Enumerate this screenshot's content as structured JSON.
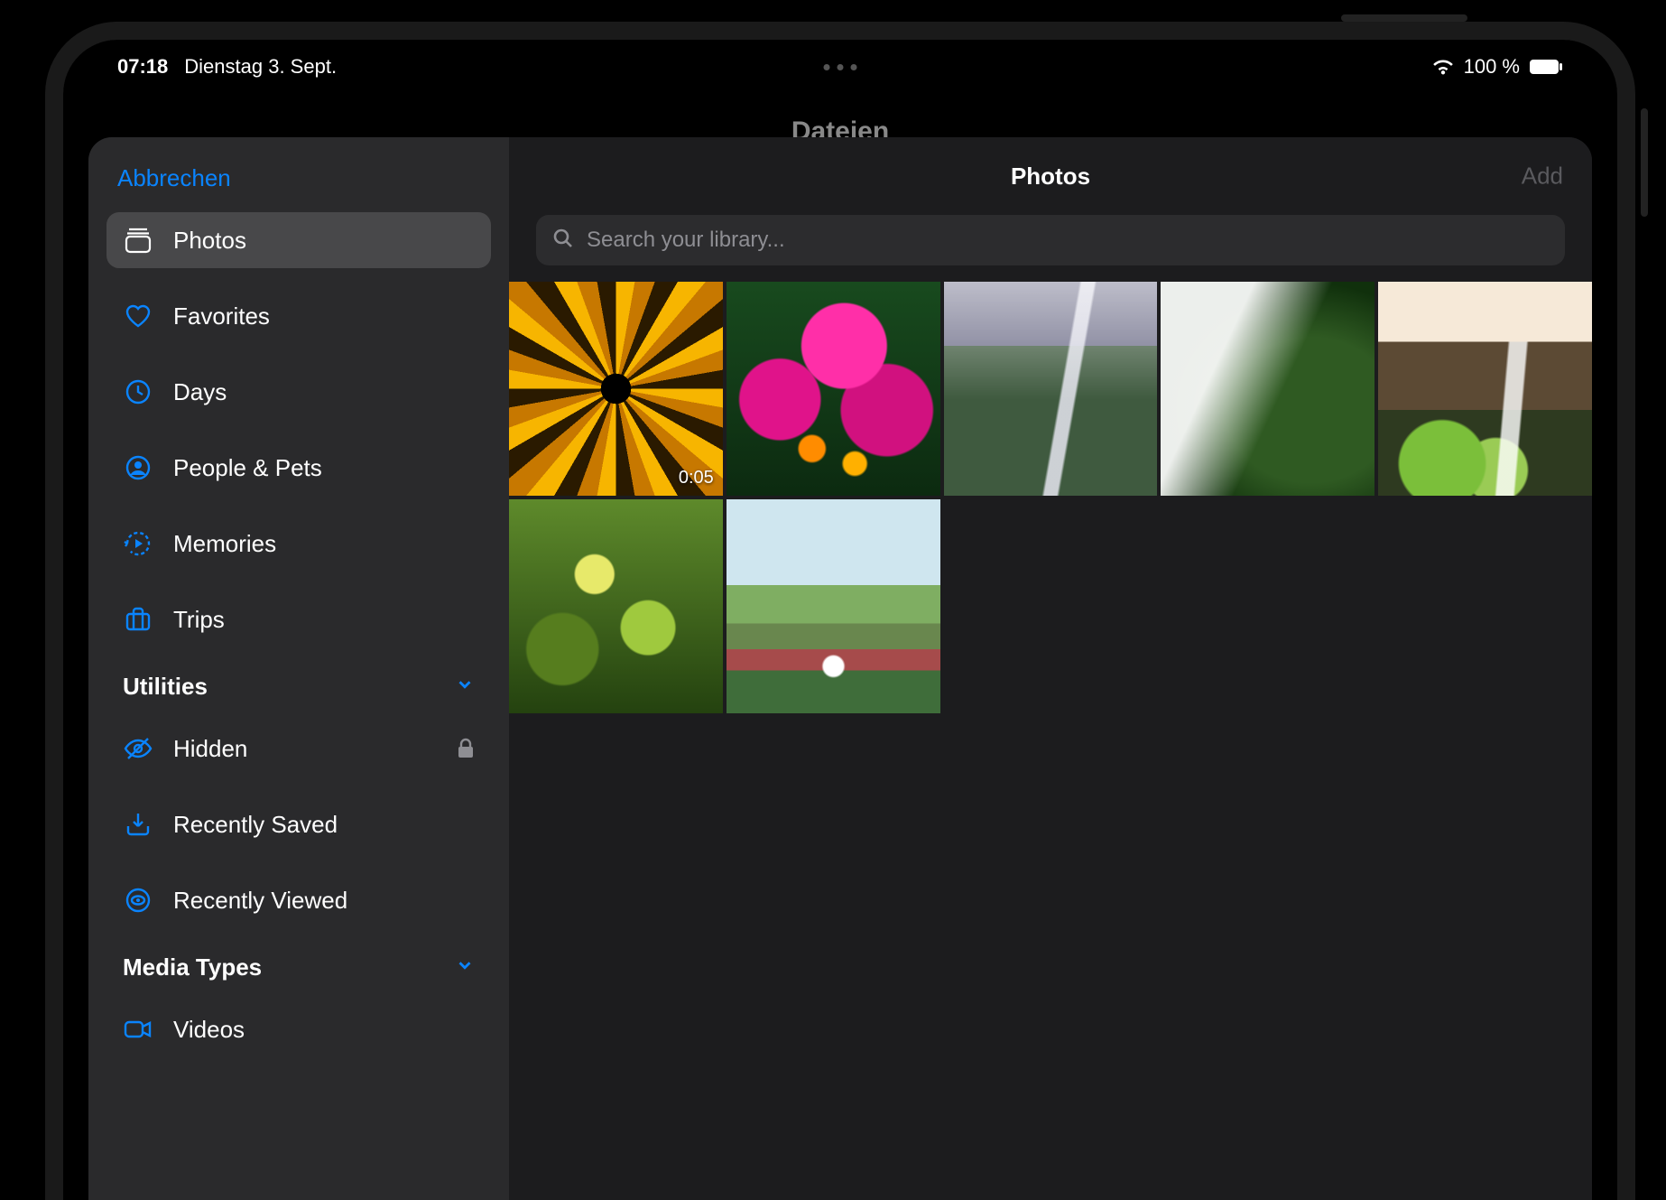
{
  "status": {
    "time": "07:18",
    "date": "Dienstag 3. Sept.",
    "battery_pct": "100 %"
  },
  "background_app": {
    "title": "Dateien"
  },
  "sheet": {
    "cancel": "Abbrechen",
    "main_title": "Photos",
    "add": "Add",
    "search_placeholder": "Search your library..."
  },
  "sidebar": {
    "items": [
      {
        "icon": "photos",
        "label": "Photos",
        "selected": true
      },
      {
        "icon": "heart",
        "label": "Favorites",
        "selected": false
      },
      {
        "icon": "clock",
        "label": "Days",
        "selected": false
      },
      {
        "icon": "person",
        "label": "People & Pets",
        "selected": false
      },
      {
        "icon": "memories",
        "label": "Memories",
        "selected": false
      },
      {
        "icon": "trips",
        "label": "Trips",
        "selected": false
      }
    ],
    "sections": [
      {
        "title": "Utilities",
        "items": [
          {
            "icon": "hidden",
            "label": "Hidden",
            "trailing": "lock"
          },
          {
            "icon": "saved",
            "label": "Recently Saved"
          },
          {
            "icon": "viewed",
            "label": "Recently Viewed"
          }
        ]
      },
      {
        "title": "Media Types",
        "items": [
          {
            "icon": "videos",
            "label": "Videos"
          }
        ]
      }
    ]
  },
  "grid": {
    "items": [
      {
        "duration": "0:05"
      },
      {},
      {},
      {},
      {},
      {},
      {}
    ]
  },
  "colors": {
    "accent": "#0a84ff",
    "sheet_bg": "#1c1c1e",
    "sidebar_bg": "#2a2a2c",
    "selected_bg": "#48484a",
    "muted": "#8e8e93"
  }
}
